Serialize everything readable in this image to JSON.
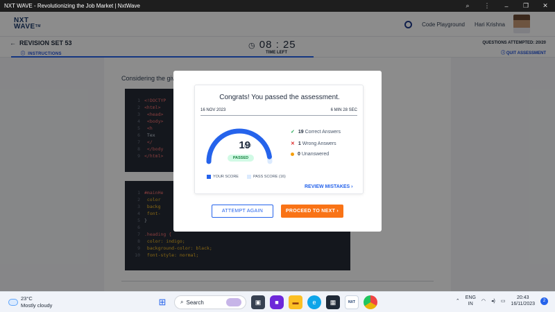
{
  "window": {
    "title": "NXT WAVE - Revolutionizing the Job Market | NxtWave"
  },
  "header": {
    "logo_line1": "NXT",
    "logo_line2": "WAVE",
    "logo_tm": "TM",
    "code_playground": "Code Playground",
    "user_name": "Hari Krishna"
  },
  "subheader": {
    "title": "REVISION SET 53",
    "instructions": "INSTRUCTIONS",
    "timer": "08 : 25",
    "time_left": "TIME LEFT",
    "questions_attempted": "QUESTIONS ATTEMPTED: 20/20",
    "quit": "QUIT ASSESSMENT"
  },
  "main": {
    "question_prefix": "Considering the giv",
    "code1": [
      {
        "n": "1",
        "t": "<!DOCTYP"
      },
      {
        "n": "2",
        "t": "<html>"
      },
      {
        "n": "3",
        "t": "  <head>"
      },
      {
        "n": "4",
        "t": "  <body>"
      },
      {
        "n": "5",
        "t": "    <h"
      },
      {
        "n": "6",
        "t": "      Tex"
      },
      {
        "n": "7",
        "t": "    </"
      },
      {
        "n": "8",
        "t": "  </body"
      },
      {
        "n": "9",
        "t": "</html>"
      }
    ],
    "code2": [
      {
        "n": "1",
        "t": "#mainHe"
      },
      {
        "n": "2",
        "t": "  color"
      },
      {
        "n": "3",
        "t": "  backg"
      },
      {
        "n": "4",
        "t": "  font-"
      },
      {
        "n": "5",
        "t": "}"
      },
      {
        "n": "6",
        "t": ""
      },
      {
        "n": "7",
        "t": ".heading {"
      },
      {
        "n": "8",
        "t": "  color: indigo;"
      },
      {
        "n": "9",
        "t": "  background-color: black;"
      },
      {
        "n": "10",
        "t": "  font-style: normal;"
      }
    ]
  },
  "modal": {
    "title": "Congrats! You passed the assessment.",
    "date": "16 NOV 2023",
    "duration": "6 MIN 28 SEC",
    "score": "19",
    "score_total": "/20",
    "score_value": 19,
    "score_max": 20,
    "pass_score_value": 16,
    "status": "PASSED",
    "correct_count": "19",
    "correct_label": "Correct Answers",
    "wrong_count": "1",
    "wrong_label": "Wrong Answers",
    "unanswered_count": "0",
    "unanswered_label": "Unanswered",
    "legend_your_score": "YOUR SCORE",
    "legend_pass_score": "PASS SCORE (16)",
    "review_mistakes": "REVIEW MISTAKES",
    "attempt_again": "ATTEMPT AGAIN",
    "proceed_next": "PROCEED TO NEXT",
    "colors": {
      "primary": "#2563eb",
      "accent": "#f97316",
      "pass_green": "#15803d"
    }
  },
  "taskbar": {
    "temp": "23°C",
    "weather": "Mostly cloudy",
    "search_placeholder": "Search",
    "lang1": "ENG",
    "lang2": "IN",
    "time": "20:43",
    "date": "16/11/2023",
    "notif_count": "2"
  }
}
